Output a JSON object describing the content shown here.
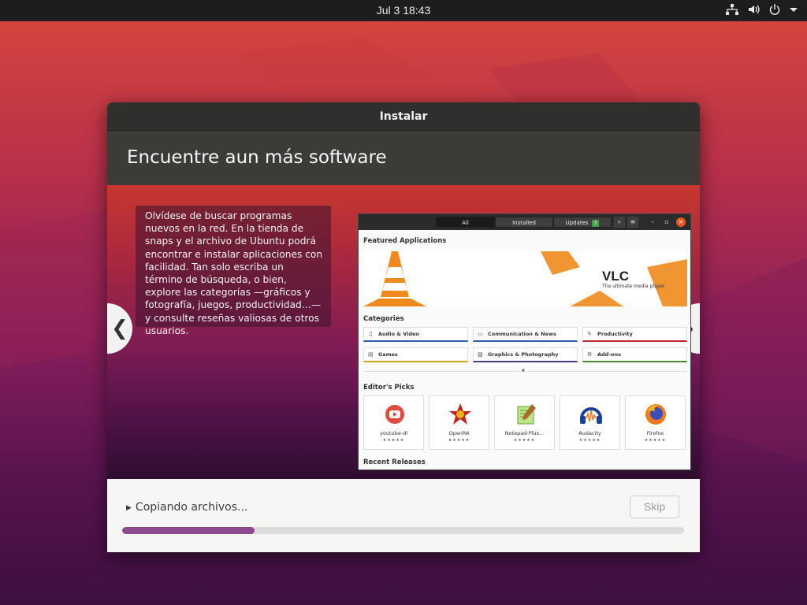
{
  "topbar": {
    "clock": "Jul 3  18:43",
    "tray_icons": [
      "network-icon",
      "volume-icon",
      "power-icon",
      "menu-arrow-icon"
    ]
  },
  "window": {
    "title": "Instalar",
    "heading": "Encuentre aun más software",
    "slide_text": "Olvídese de buscar programas nuevos en la red. En la tienda de snaps y el archivo de Ubuntu podrá encontrar e instalar aplicaciones con facilidad. Tan solo escriba un término de búsqueda, o bien, explore las categorías —gráficos y fotografía, juegos, productividad…— y consulte reseñas valiosas de otros usuarios.",
    "nav_prev": "❮",
    "nav_next": "❯",
    "status": "Copiando archivos...",
    "skip": "Skip",
    "progress": 0.235
  },
  "software_center": {
    "tabs": [
      "All",
      "Installed",
      "Updates"
    ],
    "updates_count": "3",
    "featured_heading": "Featured Applications",
    "vlc_title": "VLC",
    "vlc_subtitle": "The ultimate media player",
    "categories_heading": "Categories",
    "categories": [
      {
        "label": "Audio & Video",
        "icon": "♫",
        "color": "#2b5fa8"
      },
      {
        "label": "Communication & News",
        "icon": "▭",
        "color": "#2b5fa8"
      },
      {
        "label": "Productivity",
        "icon": "✎",
        "color": "#c0262c"
      },
      {
        "label": "Games",
        "icon": "▤",
        "color": "#d9a21b"
      },
      {
        "label": "Graphics & Photography",
        "icon": "▨",
        "color": "#4a3a85"
      },
      {
        "label": "Add-ons",
        "icon": "⚙",
        "color": "#4a8a2a"
      }
    ],
    "picks_heading": "Editor's Picks",
    "picks": [
      {
        "name": "youtube-dl",
        "stars": "★★★★★"
      },
      {
        "name": "OpenRA",
        "stars": "★★★★★"
      },
      {
        "name": "Notepad-Plus...",
        "stars": "★★★★★"
      },
      {
        "name": "Audacity",
        "stars": "★★★★★"
      },
      {
        "name": "Firefox",
        "stars": "★★★★★"
      }
    ],
    "recent_heading": "Recent Releases"
  }
}
